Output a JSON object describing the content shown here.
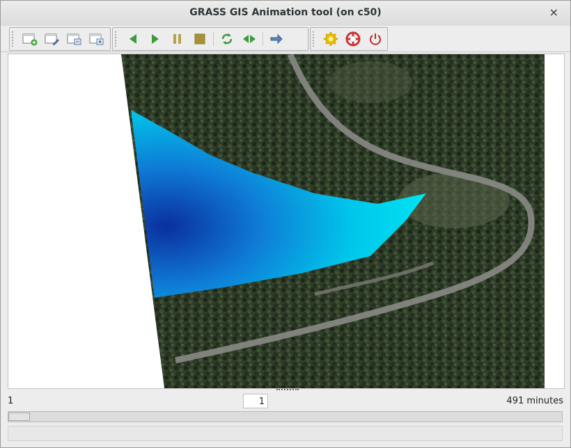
{
  "window": {
    "title": "GRASS GIS Animation tool (on c50)",
    "close_glyph": "×"
  },
  "toolbars": {
    "animation_management": [
      "add-animation-icon",
      "edit-animation-icon",
      "reload-animation-icon",
      "export-animation-icon"
    ],
    "playback": [
      "play-back-icon",
      "play-forward-icon",
      "pause-icon",
      "stop-icon",
      "loop-icon",
      "ping-pong-icon",
      "orientation-icon"
    ],
    "misc": [
      "settings-icon",
      "help-icon",
      "quit-icon"
    ]
  },
  "map_view": {
    "image_description": "aerial forest with blue water-depth overlay"
  },
  "controls": {
    "frame_left": "1",
    "frame_value": "1",
    "time_label": "491 minutes",
    "slider_position_fraction": 0.0
  },
  "statusbar": {
    "text": ""
  },
  "colors": {
    "water_light": "#00ccee",
    "water_dark": "#0a3a9e",
    "forest": "#2b3a25",
    "road": "#8b8a86"
  }
}
